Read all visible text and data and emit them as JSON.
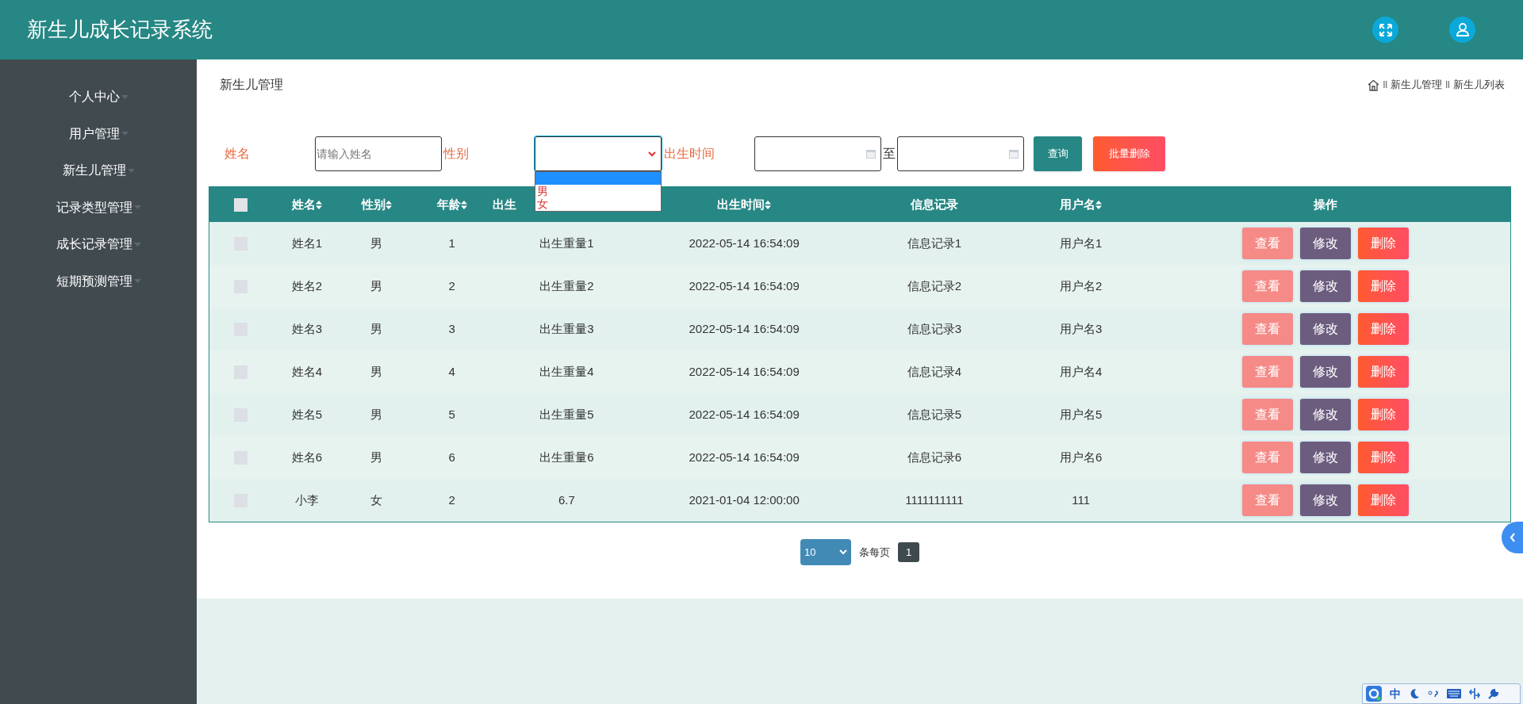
{
  "header": {
    "title": "新生儿成长记录系统"
  },
  "sidebar": {
    "items": [
      {
        "label": "个人中心",
        "expanded": false
      },
      {
        "label": "用户管理",
        "expanded": false
      },
      {
        "label": "新生儿管理",
        "expanded": false
      },
      {
        "label": "记录类型管理",
        "expanded": false
      },
      {
        "label": "成长记录管理",
        "expanded": false
      },
      {
        "label": "短期预测管理",
        "expanded": false
      }
    ]
  },
  "page_title": "新生儿管理",
  "breadcrumb": [
    {
      "separator": "ll",
      "label": "新生儿管理"
    },
    {
      "separator": "ll",
      "label": "新生儿列表"
    }
  ],
  "search": {
    "name_label": "姓名",
    "name_placeholder": "请输入姓名",
    "gender_label": "性别",
    "gender_open": true,
    "gender_options": [
      {
        "selected": true
      },
      {
        "label": "男",
        "selected": false
      },
      {
        "label": "女",
        "selected": false
      }
    ],
    "birth_label": "出生时间",
    "range_separator": "至",
    "query_button": "查询",
    "batch_delete_button": "批量删除"
  },
  "table": {
    "columns": [
      {
        "label": "姓名",
        "sortable": true
      },
      {
        "label": "性别",
        "sortable": true
      },
      {
        "label": "年龄",
        "sortable": true
      },
      {
        "label": "出生",
        "sortable": false,
        "partial": true
      },
      {
        "label": "出生时间",
        "sortable": true
      },
      {
        "label": "信息记录",
        "sortable": false
      },
      {
        "label": "用户名",
        "sortable": true
      },
      {
        "label": "操作",
        "sortable": false
      }
    ],
    "select_all_checked": false,
    "rows": [
      {
        "checked": false,
        "cells": [
          "姓名1",
          "男",
          "1",
          "出生重量1",
          "2022-05-14 16:54:09",
          "信息记录1",
          "用户名1"
        ],
        "actions": [
          {
            "label": "查看",
            "kind": "view"
          },
          {
            "label": "修改",
            "kind": "edit"
          },
          {
            "label": "删除",
            "kind": "delete"
          }
        ]
      },
      {
        "checked": false,
        "cells": [
          "姓名2",
          "男",
          "2",
          "出生重量2",
          "2022-05-14 16:54:09",
          "信息记录2",
          "用户名2"
        ],
        "actions": [
          {
            "label": "查看",
            "kind": "view"
          },
          {
            "label": "修改",
            "kind": "edit"
          },
          {
            "label": "删除",
            "kind": "delete"
          }
        ]
      },
      {
        "checked": false,
        "cells": [
          "姓名3",
          "男",
          "3",
          "出生重量3",
          "2022-05-14 16:54:09",
          "信息记录3",
          "用户名3"
        ],
        "actions": [
          {
            "label": "查看",
            "kind": "view"
          },
          {
            "label": "修改",
            "kind": "edit"
          },
          {
            "label": "删除",
            "kind": "delete"
          }
        ]
      },
      {
        "checked": false,
        "cells": [
          "姓名4",
          "男",
          "4",
          "出生重量4",
          "2022-05-14 16:54:09",
          "信息记录4",
          "用户名4"
        ],
        "actions": [
          {
            "label": "查看",
            "kind": "view"
          },
          {
            "label": "修改",
            "kind": "edit"
          },
          {
            "label": "删除",
            "kind": "delete"
          }
        ]
      },
      {
        "checked": false,
        "cells": [
          "姓名5",
          "男",
          "5",
          "出生重量5",
          "2022-05-14 16:54:09",
          "信息记录5",
          "用户名5"
        ],
        "actions": [
          {
            "label": "查看",
            "kind": "view"
          },
          {
            "label": "修改",
            "kind": "edit"
          },
          {
            "label": "删除",
            "kind": "delete"
          }
        ]
      },
      {
        "checked": false,
        "cells": [
          "姓名6",
          "男",
          "6",
          "出生重量6",
          "2022-05-14 16:54:09",
          "信息记录6",
          "用户名6"
        ],
        "actions": [
          {
            "label": "查看",
            "kind": "view"
          },
          {
            "label": "修改",
            "kind": "edit"
          },
          {
            "label": "删除",
            "kind": "delete"
          }
        ]
      },
      {
        "checked": false,
        "cells": [
          "小李",
          "女",
          "2",
          "6.7",
          "2021-01-04 12:00:00",
          "1111111111",
          "111"
        ],
        "actions": [
          {
            "label": "查看",
            "kind": "view"
          },
          {
            "label": "修改",
            "kind": "edit"
          },
          {
            "label": "删除",
            "kind": "delete"
          }
        ]
      }
    ]
  },
  "pagination": {
    "page_size": "10",
    "page_size_label": "条每页",
    "pages": [
      {
        "label": "1",
        "selected": true
      }
    ]
  },
  "ime_toolbar": {
    "mode": "中"
  }
}
